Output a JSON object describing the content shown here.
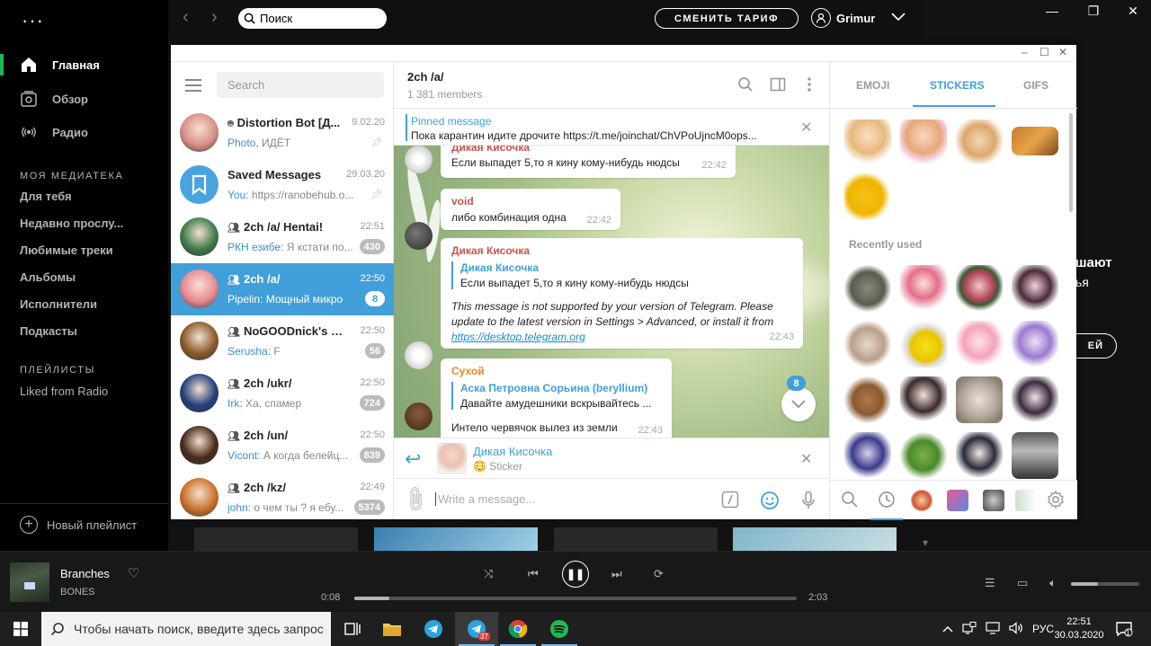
{
  "spotify": {
    "nav": [
      {
        "label": "Главная",
        "icon": "home-icon"
      },
      {
        "label": "Обзор",
        "icon": "browse-icon"
      },
      {
        "label": "Радио",
        "icon": "radio-icon"
      }
    ],
    "library_title": "МОЯ МЕДИАТЕКА",
    "library": [
      "Для тебя",
      "Недавно прослу...",
      "Любимые треки",
      "Альбомы",
      "Исполнители",
      "Подкасты"
    ],
    "playlists_title": "ПЛЕЙЛИСТЫ",
    "playlists": [
      "Liked from Radio"
    ],
    "new_playlist": "Новый плейлист",
    "search_placeholder": "Поиск",
    "upgrade": "СМЕНИТЬ ТАРИФ",
    "user": "Grimur",
    "promo_line1": "шают",
    "promo_line2": "ья",
    "promo_button": "ЕЙ",
    "player": {
      "title": "Branches",
      "artist": "BONES",
      "time_current": "0:08",
      "time_total": "2:03",
      "progress": 0.08,
      "volume": 0.4
    }
  },
  "telegram": {
    "search_placeholder": "Search",
    "chats": [
      {
        "name": "Distortion Bot [Д...",
        "time": "9.02.20",
        "sender": "Photo, ",
        "preview": "ИДЁТ",
        "badge": "",
        "pinned": true,
        "group": false,
        "bot": true,
        "color": "#d98f86"
      },
      {
        "name": "Saved Messages",
        "time": "29.03.20",
        "sender": "You: ",
        "preview": "https://ranobehub.o...",
        "badge": "",
        "pinned": true,
        "group": false,
        "bot": false,
        "color": "#4aa3df"
      },
      {
        "name": "2ch /a/ Hentai!",
        "time": "22:51",
        "sender": "РКН езибе: ",
        "preview": "Я кстати по...",
        "badge": "430",
        "pinned": false,
        "group": true,
        "bot": false,
        "color": "#3f7a4a"
      },
      {
        "name": "2ch /a/",
        "time": "22:50",
        "sender": "Pipelin: ",
        "preview": "Мощный микро",
        "badge": "8",
        "pinned": false,
        "group": true,
        "bot": false,
        "color": "#e98a93"
      },
      {
        "name": "NoGOODnick's chat",
        "time": "22:50",
        "sender": "Serusha: ",
        "preview": "F",
        "badge": "56",
        "pinned": false,
        "group": true,
        "bot": false,
        "color": "#8a5a2a"
      },
      {
        "name": "2ch /ukr/",
        "time": "22:50",
        "sender": "Irk: ",
        "preview": "Ха, спамер",
        "badge": "724",
        "pinned": false,
        "group": true,
        "bot": false,
        "color": "#24407a"
      },
      {
        "name": "2ch /un/",
        "time": "22:50",
        "sender": "Vicont: ",
        "preview": "А когда белейц...",
        "badge": "839",
        "pinned": false,
        "group": true,
        "bot": false,
        "color": "#4a2a1a"
      },
      {
        "name": "2ch /kz/",
        "time": "22:49",
        "sender": "john: ",
        "preview": "о чем ты ? я ебу...",
        "badge": "5374",
        "pinned": false,
        "group": true,
        "bot": false,
        "color": "#c9722a"
      }
    ],
    "header": {
      "title": "2ch /a/",
      "members": "1 381 members"
    },
    "pinned": {
      "label": "Pinned message",
      "text": "Пока карантин идите дрочите https://t.me/joinchat/ChVPoUjncM0ops..."
    },
    "messages": {
      "m1": {
        "from": "Дикая Кисочка",
        "text": "Если выпадет 5,то я кину кому-нибудь нюдсы",
        "time": "22:42"
      },
      "m2": {
        "from": "void",
        "text": "либо комбинация одна",
        "time": "22:42"
      },
      "m3": {
        "from": "Дикая Кисочка",
        "quote_name": "Дикая Кисочка",
        "quote_text": "Если выпадет 5,то я кину кому-нибудь нюдсы",
        "unsupported": "This message is not supported by your version of Telegram. Please update to the latest version in Settings > Advanced, or install it from",
        "link": "https://desktop.telegram.org",
        "time": "22:43"
      },
      "m4": {
        "from": "Сухой",
        "quote_name": "Аска Петровна Сорьина (beryllium)",
        "quote_text": "Давайте амудешники вскрывайтесь ...",
        "text": "Интело червячок вылез из земли",
        "time": "22:43"
      }
    },
    "unread": "8",
    "reply": {
      "name": "Дикая Кисочка",
      "emoji": "😳",
      "text": "Sticker"
    },
    "compose_placeholder": "Write a message...",
    "emoji_tabs": [
      "EMOJI",
      "STICKERS",
      "GIFS"
    ],
    "recently_used": "Recently used"
  },
  "taskbar": {
    "search_placeholder": "Чтобы начать поиск, введите здесь запрос",
    "telegram_badge": "37",
    "lang": "РУС",
    "time": "22:51",
    "date": "30.03.2020",
    "notifications": "1"
  },
  "colors": {
    "spotify_green": "#1db954",
    "telegram_blue": "#419fd9",
    "reply_name_red": "#c9534a",
    "reply_name_orange": "#e08b2a"
  }
}
